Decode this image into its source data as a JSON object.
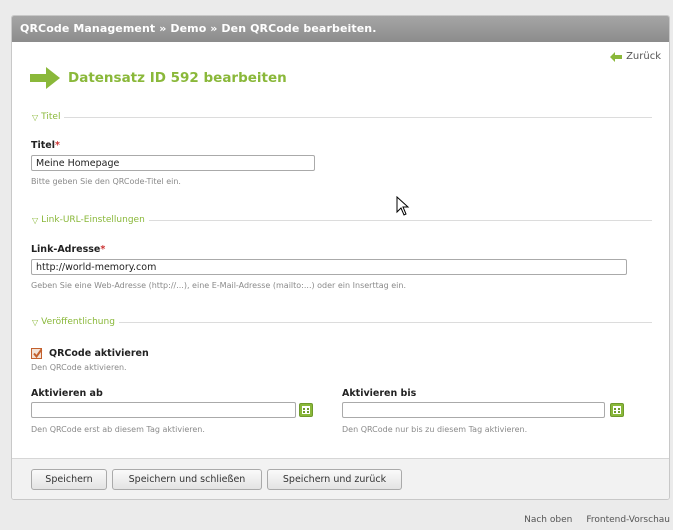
{
  "breadcrumb": "QRCode Management » Demo » Den QRCode bearbeiten.",
  "back_label": "Zurück",
  "headline": "Datensatz ID 592 bearbeiten",
  "sections": {
    "title": "Titel",
    "link": "Link-URL-Einstellungen",
    "publish": "Veröffentlichung"
  },
  "fields": {
    "title": {
      "label": "Titel",
      "required": "*",
      "value": "Meine Homepage",
      "help": "Bitte geben Sie den QRCode-Titel ein."
    },
    "link": {
      "label": "Link-Adresse",
      "required": "*",
      "value": "http://world-memory.com",
      "help": "Geben Sie eine Web-Adresse (http://...), eine E-Mail-Adresse (mailto:...) oder ein Inserttag ein."
    },
    "activate": {
      "label": "QRCode aktivieren",
      "checked": true,
      "help": "Den QRCode aktivieren."
    },
    "start": {
      "label": "Aktivieren ab",
      "value": "",
      "help": "Den QRCode erst ab diesem Tag aktivieren."
    },
    "stop": {
      "label": "Aktivieren bis",
      "value": "",
      "help": "Den QRCode nur bis zu diesem Tag aktivieren."
    }
  },
  "buttons": {
    "save": "Speichern",
    "save_close": "Speichern und schließen",
    "save_back": "Speichern und zurück"
  },
  "bottom_links": {
    "top": "Nach oben",
    "preview": "Frontend-Vorschau"
  },
  "colors": {
    "accent": "#8ab83a",
    "titlebar": "#999999",
    "required": "#cc3333"
  }
}
